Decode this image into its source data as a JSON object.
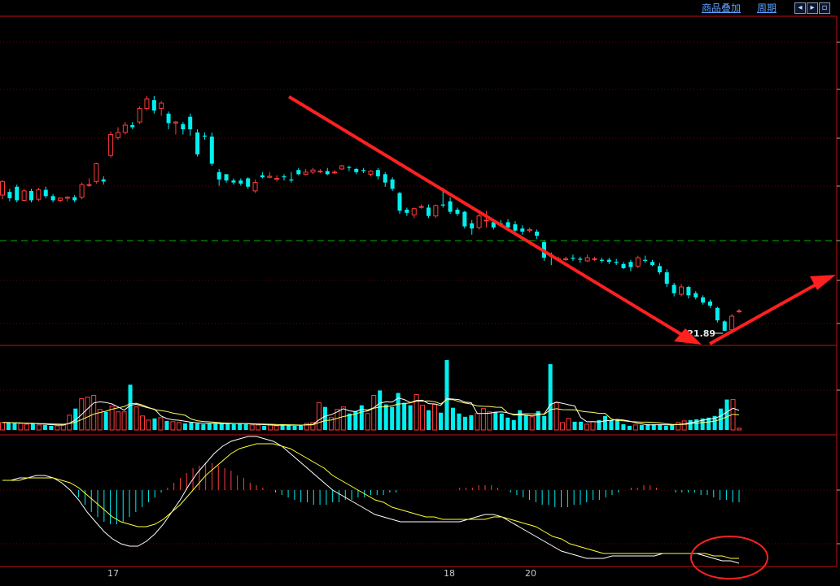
{
  "header": {
    "overlay_label": "商品叠加",
    "period_label": "周期",
    "nav_buttons": [
      {
        "name": "nav-left-button",
        "glyph": "◂"
      },
      {
        "name": "nav-right-button",
        "glyph": "▸"
      },
      {
        "name": "nav-maximize-button",
        "glyph": "▫"
      }
    ]
  },
  "xaxis": {
    "labels": [
      "17",
      "18",
      "20"
    ]
  },
  "colors": {
    "up": "#ff3c3c",
    "down": "#00f0f0",
    "grid": "#7a0000",
    "ma": "#ffff66",
    "price_ref": "#00b000",
    "signal": "#ffff33",
    "annotation": "#ff2020"
  },
  "chart_data": [
    {
      "type": "candlestick",
      "panel": "price",
      "low_label": "21.89",
      "reference_line": "dashed green horizontal level",
      "candles": [
        {
          "o": 130,
          "c": 143,
          "h": 144,
          "l": 126
        },
        {
          "o": 133,
          "c": 127,
          "h": 136,
          "l": 124
        },
        {
          "o": 138,
          "c": 125,
          "h": 140,
          "l": 123
        },
        {
          "o": 125,
          "c": 134,
          "h": 136,
          "l": 124
        },
        {
          "o": 134,
          "c": 125,
          "h": 136,
          "l": 123
        },
        {
          "o": 126,
          "c": 135,
          "h": 137,
          "l": 124
        },
        {
          "o": 135,
          "c": 129,
          "h": 138,
          "l": 127
        },
        {
          "o": 129,
          "c": 125,
          "h": 131,
          "l": 123
        },
        {
          "o": 125,
          "c": 127,
          "h": 128,
          "l": 123
        },
        {
          "o": 127,
          "c": 128,
          "h": 129,
          "l": 124
        },
        {
          "o": 128,
          "c": 125,
          "h": 130,
          "l": 123
        },
        {
          "o": 128,
          "c": 140,
          "h": 142,
          "l": 126
        },
        {
          "o": 140,
          "c": 140,
          "h": 146,
          "l": 138
        },
        {
          "o": 143,
          "c": 160,
          "h": 161,
          "l": 141
        },
        {
          "o": 145,
          "c": 143,
          "h": 148,
          "l": 140
        },
        {
          "o": 168,
          "c": 188,
          "h": 191,
          "l": 166
        },
        {
          "o": 185,
          "c": 190,
          "h": 195,
          "l": 183
        },
        {
          "o": 190,
          "c": 197,
          "h": 200,
          "l": 188
        },
        {
          "o": 197,
          "c": 195,
          "h": 200,
          "l": 193
        },
        {
          "o": 200,
          "c": 213,
          "h": 215,
          "l": 198
        },
        {
          "o": 213,
          "c": 222,
          "h": 225,
          "l": 211
        },
        {
          "o": 221,
          "c": 211,
          "h": 225,
          "l": 208
        },
        {
          "o": 213,
          "c": 218,
          "h": 220,
          "l": 206
        },
        {
          "o": 208,
          "c": 199,
          "h": 210,
          "l": 193
        },
        {
          "o": 199,
          "c": 200,
          "h": 201,
          "l": 188
        },
        {
          "o": 198,
          "c": 193,
          "h": 200,
          "l": 188
        },
        {
          "o": 205,
          "c": 193,
          "h": 208,
          "l": 187
        },
        {
          "o": 190,
          "c": 169,
          "h": 193,
          "l": 167
        },
        {
          "o": 187,
          "c": 186,
          "h": 190,
          "l": 183
        },
        {
          "o": 186,
          "c": 160,
          "h": 190,
          "l": 158
        },
        {
          "o": 152,
          "c": 145,
          "h": 155,
          "l": 139
        },
        {
          "o": 150,
          "c": 144,
          "h": 150,
          "l": 142
        },
        {
          "o": 144,
          "c": 142,
          "h": 146,
          "l": 140
        },
        {
          "o": 144,
          "c": 141,
          "h": 146,
          "l": 139
        },
        {
          "o": 146,
          "c": 138,
          "h": 147,
          "l": 136
        },
        {
          "o": 134,
          "c": 142,
          "h": 145,
          "l": 132
        },
        {
          "o": 149,
          "c": 147,
          "h": 152,
          "l": 146
        },
        {
          "o": 147,
          "c": 148,
          "h": 152,
          "l": 146
        },
        {
          "o": 145,
          "c": 146,
          "h": 149,
          "l": 143
        },
        {
          "o": 148,
          "c": 147,
          "h": 150,
          "l": 144
        },
        {
          "o": 145,
          "c": 144,
          "h": 152,
          "l": 142
        },
        {
          "o": 154,
          "c": 150,
          "h": 156,
          "l": 149
        },
        {
          "o": 150,
          "c": 152,
          "h": 155,
          "l": 149
        },
        {
          "o": 152,
          "c": 154,
          "h": 156,
          "l": 150
        },
        {
          "o": 153,
          "c": 153,
          "h": 155,
          "l": 151
        },
        {
          "o": 153,
          "c": 150,
          "h": 156,
          "l": 149
        },
        {
          "o": 152,
          "c": 152,
          "h": 154,
          "l": 150
        },
        {
          "o": 155,
          "c": 158,
          "h": 159,
          "l": 154
        },
        {
          "o": 157,
          "c": 156,
          "h": 158,
          "l": 153
        },
        {
          "o": 155,
          "c": 152,
          "h": 156,
          "l": 150
        },
        {
          "o": 154,
          "c": 153,
          "h": 156,
          "l": 151
        },
        {
          "o": 150,
          "c": 153,
          "h": 154,
          "l": 148
        },
        {
          "o": 154,
          "c": 148,
          "h": 156,
          "l": 145
        },
        {
          "o": 150,
          "c": 142,
          "h": 152,
          "l": 138
        },
        {
          "o": 145,
          "c": 136,
          "h": 147,
          "l": 134
        },
        {
          "o": 132,
          "c": 115,
          "h": 133,
          "l": 112
        },
        {
          "o": 116,
          "c": 113,
          "h": 118,
          "l": 110
        },
        {
          "o": 111,
          "c": 117,
          "h": 118,
          "l": 108
        },
        {
          "o": 119,
          "c": 119,
          "h": 121,
          "l": 117
        },
        {
          "o": 118,
          "c": 110,
          "h": 121,
          "l": 108
        },
        {
          "o": 110,
          "c": 120,
          "h": 121,
          "l": 108
        },
        {
          "o": 121,
          "c": 120,
          "h": 137,
          "l": 118
        },
        {
          "o": 124,
          "c": 114,
          "h": 128,
          "l": 112
        },
        {
          "o": 116,
          "c": 112,
          "h": 118,
          "l": 110
        },
        {
          "o": 114,
          "c": 100,
          "h": 115,
          "l": 98
        },
        {
          "o": 103,
          "c": 98,
          "h": 106,
          "l": 92
        },
        {
          "o": 99,
          "c": 110,
          "h": 112,
          "l": 97
        },
        {
          "o": 106,
          "c": 106,
          "h": 115,
          "l": 99
        },
        {
          "o": 104,
          "c": 99,
          "h": 106,
          "l": 97
        },
        {
          "o": 103,
          "c": 102,
          "h": 106,
          "l": 100
        },
        {
          "o": 104,
          "c": 99,
          "h": 107,
          "l": 97
        },
        {
          "o": 102,
          "c": 96,
          "h": 105,
          "l": 93
        },
        {
          "o": 98,
          "c": 95,
          "h": 101,
          "l": 92
        },
        {
          "o": 96,
          "c": 97,
          "h": 99,
          "l": 94
        },
        {
          "o": 95,
          "c": 91,
          "h": 97,
          "l": 88
        },
        {
          "o": 85,
          "c": 70,
          "h": 86,
          "l": 67
        },
        {
          "o": 73,
          "c": 71,
          "h": 75,
          "l": 63
        },
        {
          "o": 69,
          "c": 69,
          "h": 71,
          "l": 66
        },
        {
          "o": 69,
          "c": 69,
          "h": 71,
          "l": 67
        },
        {
          "o": 70,
          "c": 69,
          "h": 73,
          "l": 67
        },
        {
          "o": 69,
          "c": 68,
          "h": 71,
          "l": 65
        },
        {
          "o": 67,
          "c": 70,
          "h": 73,
          "l": 66
        },
        {
          "o": 69,
          "c": 69,
          "h": 71,
          "l": 67
        },
        {
          "o": 68,
          "c": 67,
          "h": 70,
          "l": 65
        },
        {
          "o": 68,
          "c": 66,
          "h": 70,
          "l": 64
        },
        {
          "o": 66,
          "c": 65,
          "h": 69,
          "l": 63
        },
        {
          "o": 64,
          "c": 60,
          "h": 66,
          "l": 59
        },
        {
          "o": 66,
          "c": 61,
          "h": 68,
          "l": 57
        },
        {
          "o": 62,
          "c": 70,
          "h": 72,
          "l": 60
        },
        {
          "o": 68,
          "c": 67,
          "h": 72,
          "l": 65
        },
        {
          "o": 66,
          "c": 63,
          "h": 68,
          "l": 62
        },
        {
          "o": 62,
          "c": 56,
          "h": 65,
          "l": 54
        },
        {
          "o": 56,
          "c": 45,
          "h": 59,
          "l": 42
        },
        {
          "o": 44,
          "c": 36,
          "h": 46,
          "l": 33
        },
        {
          "o": 35,
          "c": 42,
          "h": 45,
          "l": 33
        },
        {
          "o": 42,
          "c": 34,
          "h": 43,
          "l": 31
        },
        {
          "o": 36,
          "c": 32,
          "h": 38,
          "l": 30
        },
        {
          "o": 32,
          "c": 27,
          "h": 34,
          "l": 25
        },
        {
          "o": 28,
          "c": 24,
          "h": 30,
          "l": 22
        },
        {
          "o": 22,
          "c": 10,
          "h": 23,
          "l": 8
        },
        {
          "o": 9,
          "c": 0,
          "h": 10,
          "l": 0
        },
        {
          "o": 1,
          "c": 14,
          "h": 16,
          "l": 0
        },
        {
          "o": 19,
          "c": 19,
          "h": 21,
          "l": 17
        }
      ]
    },
    {
      "type": "bar",
      "panel": "volume",
      "values": [
        9,
        9,
        8,
        8,
        7,
        8,
        6,
        6,
        5,
        5,
        7,
        18,
        26,
        38,
        40,
        42,
        25,
        22,
        29,
        22,
        22,
        55,
        28,
        17,
        12,
        14,
        15,
        11,
        10,
        9,
        8,
        9,
        8,
        7,
        8,
        8,
        8,
        8,
        7,
        8,
        7,
        6,
        6,
        5,
        6,
        5,
        7,
        6,
        5,
        6,
        8,
        9,
        33,
        28,
        15,
        25,
        28,
        20,
        23,
        30,
        20,
        42,
        48,
        31,
        28,
        45,
        33,
        30,
        43,
        30,
        24,
        31,
        21,
        85,
        27,
        20,
        16,
        18,
        20,
        26,
        22,
        22,
        20,
        15,
        12,
        24,
        18,
        16,
        23,
        17,
        80,
        33,
        9,
        14,
        10,
        10,
        7,
        10,
        12,
        17,
        12,
        13,
        7,
        5,
        6,
        6,
        7,
        7,
        6,
        5,
        6,
        9,
        11,
        12,
        13,
        14,
        15,
        17,
        26,
        37,
        37,
        2
      ],
      "ma_lines": 2
    },
    {
      "type": "bar",
      "panel": "macd",
      "values": [
        0,
        0,
        0,
        0,
        0,
        0,
        0,
        0,
        0,
        0,
        0,
        0,
        -3,
        -6,
        -9,
        -11,
        -13,
        -14,
        -14,
        -13,
        -11,
        -9,
        -7,
        -5,
        -3,
        -1,
        1,
        3,
        5,
        7,
        9,
        10,
        11,
        11,
        10,
        9,
        8,
        6,
        5,
        3,
        2,
        1,
        0,
        -1,
        -2,
        -3,
        -4,
        -5,
        -5,
        -6,
        -6,
        -6,
        -5,
        -5,
        -4,
        -4,
        -3,
        -3,
        -2,
        -2,
        -2,
        -1,
        -1,
        0,
        0,
        0,
        0,
        0,
        0,
        0,
        0,
        0,
        1,
        1,
        1,
        2,
        2,
        2,
        1,
        0,
        -1,
        -2,
        -3,
        -4,
        -5,
        -6,
        -6,
        -7,
        -7,
        -7,
        -6,
        -6,
        -5,
        -4,
        -4,
        -3,
        -2,
        -1,
        0,
        1,
        1,
        2,
        2,
        1,
        0,
        0,
        -1,
        -1,
        -1,
        -1,
        -2,
        -2,
        -3,
        -4,
        -4,
        -5,
        -5
      ],
      "dif": [
        4,
        4,
        5,
        5,
        6,
        6,
        5,
        3,
        0,
        -4,
        -9,
        -13,
        -17,
        -20,
        -22,
        -23,
        -23,
        -21,
        -18,
        -14,
        -9,
        -4,
        2,
        7,
        11,
        15,
        18,
        20,
        21,
        22,
        22,
        21,
        20,
        18,
        15,
        12,
        9,
        6,
        3,
        0,
        -2,
        -4,
        -6,
        -8,
        -10,
        -11,
        -12,
        -13,
        -13,
        -13,
        -13,
        -13,
        -13,
        -13,
        -13,
        -12,
        -11,
        -10,
        -10,
        -11,
        -13,
        -15,
        -17,
        -19,
        -21,
        -23,
        -25,
        -26,
        -27,
        -28,
        -28,
        -28,
        -27,
        -27,
        -27,
        -27,
        -27,
        -27,
        -26,
        -26,
        -26,
        -26,
        -26,
        -27,
        -28,
        -29,
        -29,
        -30
      ],
      "dea": [
        4,
        4,
        4,
        5,
        5,
        5,
        5,
        4,
        3,
        1,
        -2,
        -5,
        -8,
        -11,
        -13,
        -14,
        -15,
        -15,
        -14,
        -12,
        -9,
        -6,
        -2,
        2,
        6,
        9,
        12,
        15,
        17,
        18,
        19,
        19,
        19,
        18,
        17,
        15,
        13,
        11,
        9,
        6,
        4,
        2,
        0,
        -2,
        -4,
        -5,
        -7,
        -8,
        -9,
        -10,
        -11,
        -11,
        -12,
        -12,
        -12,
        -12,
        -12,
        -12,
        -11,
        -11,
        -12,
        -13,
        -14,
        -15,
        -17,
        -19,
        -20,
        -22,
        -23,
        -24,
        -25,
        -26,
        -26,
        -26,
        -26,
        -26,
        -26,
        -26,
        -26,
        -26,
        -26,
        -26,
        -26,
        -26,
        -27,
        -27,
        -28,
        -28
      ]
    }
  ]
}
